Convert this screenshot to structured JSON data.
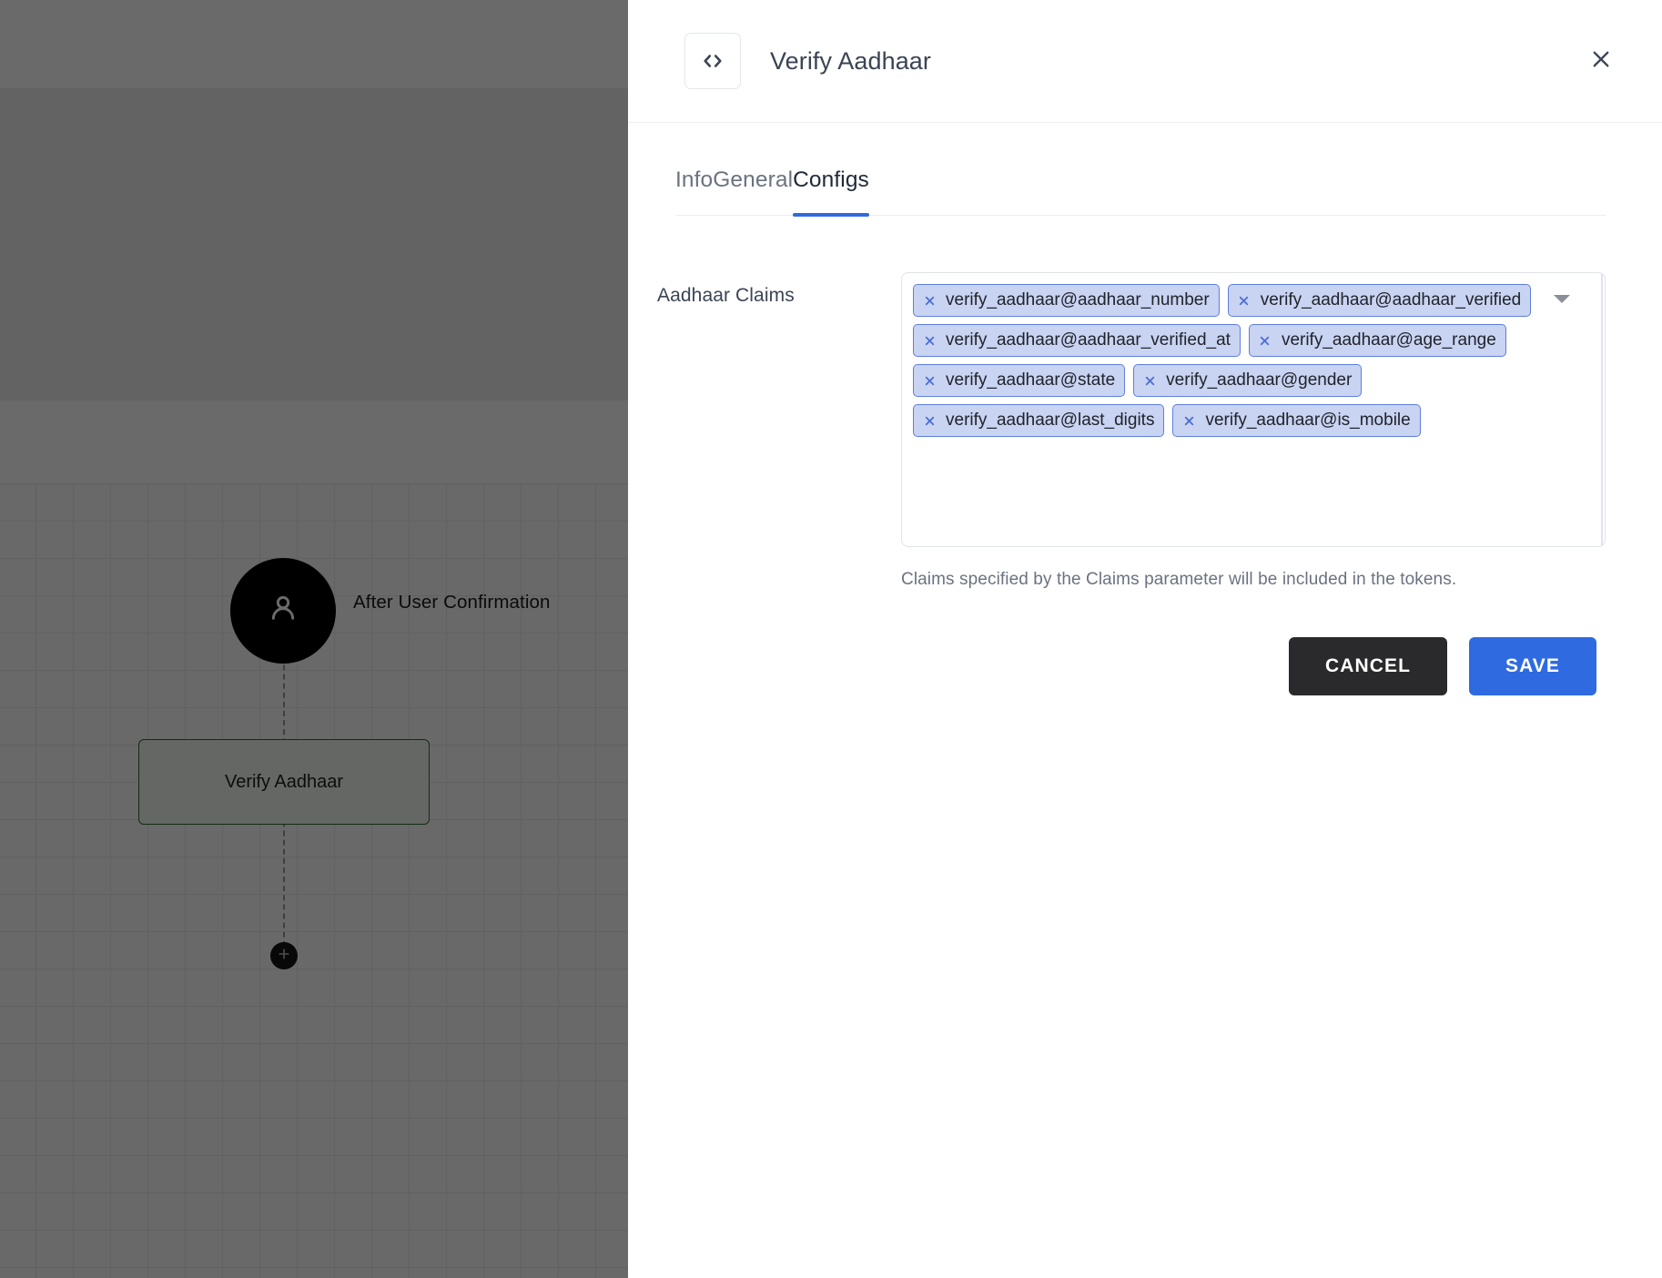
{
  "canvas": {
    "trigger": {
      "icon": "user-icon",
      "label": "After User Confirmation"
    },
    "step": {
      "label": "Verify Aadhaar"
    },
    "add_button": {
      "icon": "plus-icon"
    },
    "grid_color": "#e8e8e8",
    "node_border_color": "#2f6b33"
  },
  "panel": {
    "header": {
      "icon": "code-brackets-icon",
      "title": "Verify Aadhaar",
      "close_icon": "close-icon"
    },
    "tabs": [
      {
        "label": "Info",
        "active": false
      },
      {
        "label": "General",
        "active": false
      },
      {
        "label": "Configs",
        "active": true
      }
    ],
    "active_tab_color": "#2f6ae0",
    "form": {
      "field_label": "Aadhaar Claims",
      "dropdown_icon": "chevron-down-icon",
      "chip_remove_icon": "close-icon",
      "chips": [
        "verify_aadhaar@aadhaar_number",
        "verify_aadhaar@aadhaar_verified",
        "verify_aadhaar@aadhaar_verified_at",
        "verify_aadhaar@age_range",
        "verify_aadhaar@state",
        "verify_aadhaar@gender",
        "verify_aadhaar@last_digits",
        "verify_aadhaar@is_mobile"
      ],
      "helper_text": "Claims specified by the Claims parameter will be included in the tokens.",
      "chip_bg_color": "#c9d3f2",
      "chip_border_color": "#5f7fdb"
    },
    "actions": {
      "cancel_label": "CANCEL",
      "save_label": "SAVE",
      "cancel_bg": "#2a2a2c",
      "save_bg": "#2f6ae0"
    }
  }
}
